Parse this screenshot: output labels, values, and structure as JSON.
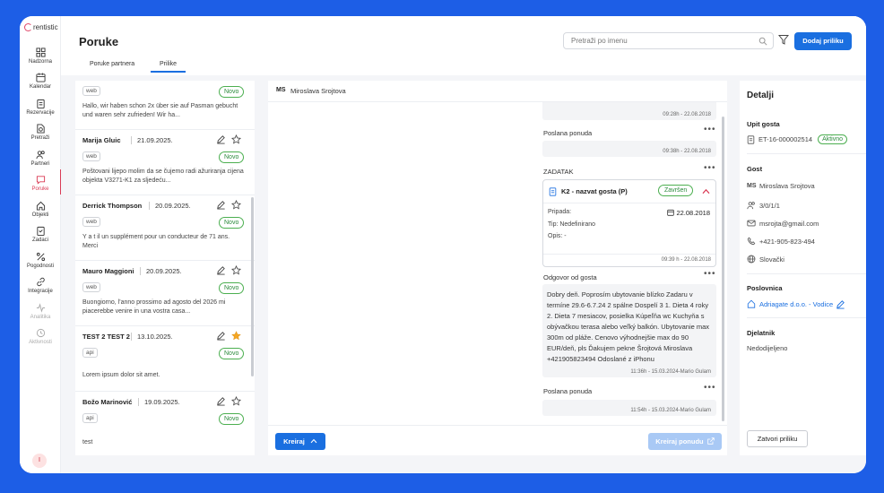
{
  "app": {
    "logo_text": "rentistic"
  },
  "nav": {
    "items": [
      {
        "label": "Nadzorna",
        "icon": "dashboard-icon"
      },
      {
        "label": "Kalendar",
        "icon": "calendar-icon"
      },
      {
        "label": "Rezervacije",
        "icon": "clipboard-icon"
      },
      {
        "label": "Pretraži",
        "icon": "search-doc-icon"
      },
      {
        "label": "Partneri",
        "icon": "users-icon"
      },
      {
        "label": "Poruke",
        "icon": "chat-icon",
        "active": true
      },
      {
        "label": "Objekti",
        "icon": "home-icon"
      },
      {
        "label": "Zadaci",
        "icon": "tasks-icon"
      },
      {
        "label": "Pogodnosti",
        "icon": "percent-icon"
      },
      {
        "label": "Integracije",
        "icon": "link-icon"
      },
      {
        "label": "Analitika",
        "icon": "pulse-icon",
        "dim": true
      },
      {
        "label": "Aktivnosti",
        "icon": "history-icon",
        "dim": true
      }
    ],
    "user_initial": "I"
  },
  "header": {
    "title": "Poruke",
    "tabs": [
      {
        "label": "Poruke partnera"
      },
      {
        "label": "Prilike",
        "active": true
      }
    ],
    "search_placeholder": "Pretraži po imenu",
    "add_button": "Dodaj priliku"
  },
  "list": {
    "cards": [
      {
        "name": "",
        "date": "",
        "source": "web",
        "badge": "Novo",
        "message": "Hallo, wir haben schon 2x über sie auf Pasman gebucht und waren sehr zufrieden! Wir ha...",
        "starred": true
      },
      {
        "name": "Marija Gluic",
        "date": "21.09.2025.",
        "source": "web",
        "badge": "Novo",
        "message": "Poštovani lijepo molim da se čujemo radi ažuriranja cijena objekta V3271-K1 za sljedeću...",
        "starred": false
      },
      {
        "name": "Derrick Thompson",
        "date": "20.09.2025.",
        "source": "web",
        "badge": "Novo",
        "message": "Y a t il un supplément pour un conducteur de 71 ans. Merci",
        "starred": false
      },
      {
        "name": "Mauro Maggioni",
        "date": "20.09.2025.",
        "source": "web",
        "badge": "Novo",
        "message": "Buongiorno, l'anno prossimo ad agosto del 2026 mi piacerebbe venire in una vostra casa...",
        "starred": false
      },
      {
        "name": "TEST 2 TEST 2",
        "date": "13.10.2025.",
        "source": "api",
        "badge": "Novo",
        "message": "Lorem ipsum dolor sit amet.",
        "starred": true
      },
      {
        "name": "Božo Marinović",
        "date": "19.09.2025.",
        "source": "api",
        "badge": "Novo",
        "message": "test",
        "starred": false
      }
    ]
  },
  "conversation": {
    "initials": "MS",
    "name": "Miroslava Srojtova",
    "top_time": "09:28h - 22.08.2018",
    "offer1": {
      "title": "Poslana ponuda",
      "time": "09:38h - 22.08.2018"
    },
    "task": {
      "section": "ZADATAK",
      "title": "K2 - nazvat gosta (P)",
      "status": "Završen",
      "pripada": "Pripada:",
      "date": "22.08.2018",
      "tip": "Tip: Nedefinirano",
      "opis": "Opis: -",
      "time": "09:39 h - 22.08.2018"
    },
    "reply": {
      "title": "Odgovor od gosta",
      "text": "Dobry deň. Poprosím ubytovanie blízko Zadaru v termíne 29.6-6.7.24 2 spálne Dospelí 3 1. Dieta 4 roky 2. Dieta 7 mesiacov, posielka Kúpeľňa wc Kuchyňa s obývačkou terasa alebo veľký balkón. Ubytovanie max 300m od pláže. Cenovo výhodnejšie max do 90 EUR/deň, pls Ďakujem pekne Šrojtová Miroslava +421905823494 Odoslané z iPhonu",
      "time": "11:36h - 15.03.2024-Mario Gulam"
    },
    "offer2": {
      "title": "Poslana ponuda",
      "time": "11:54h - 15.03.2024-Mario Gulam"
    },
    "create_button": "Kreiraj",
    "create_offer_button": "Kreiraj ponudu"
  },
  "details": {
    "title": "Detalji",
    "inquiry": {
      "section": "Upit gosta",
      "id": "ET-16-000002514",
      "status": "Aktivno"
    },
    "guest": {
      "section": "Gost",
      "initials": "MS",
      "name": "Miroslava Srojtova",
      "people": "3/0/1/1",
      "email": "msrojta@gmail.com",
      "phone": "+421-905-823-494",
      "country": "Slovački"
    },
    "office": {
      "section": "Poslovnica",
      "name": "Adriagate d.o.o. - Vodice"
    },
    "employee": {
      "section": "Djelatnik",
      "name": "Nedodijeljeno"
    },
    "close_button": "Zatvori priliku"
  },
  "colors": {
    "accent": "#1a6fe0",
    "active_nav": "#d93b55",
    "success": "#4caf50",
    "star": "#f5a623"
  }
}
